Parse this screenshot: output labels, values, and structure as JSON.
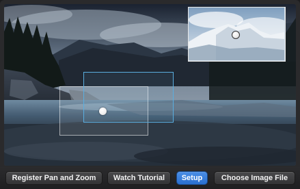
{
  "toolbar": {
    "register_label": "Register Pan and Zoom",
    "tutorial_label": "Watch Tutorial",
    "setup_label": "Setup",
    "choose_label": "Choose Image File"
  },
  "colors": {
    "accent": "#3a7fdc",
    "crop_inner_stroke": "#5aaee0",
    "background": "#1c1c1e"
  },
  "icons": [
    "position-handle-icon",
    "preview-handle-icon"
  ]
}
